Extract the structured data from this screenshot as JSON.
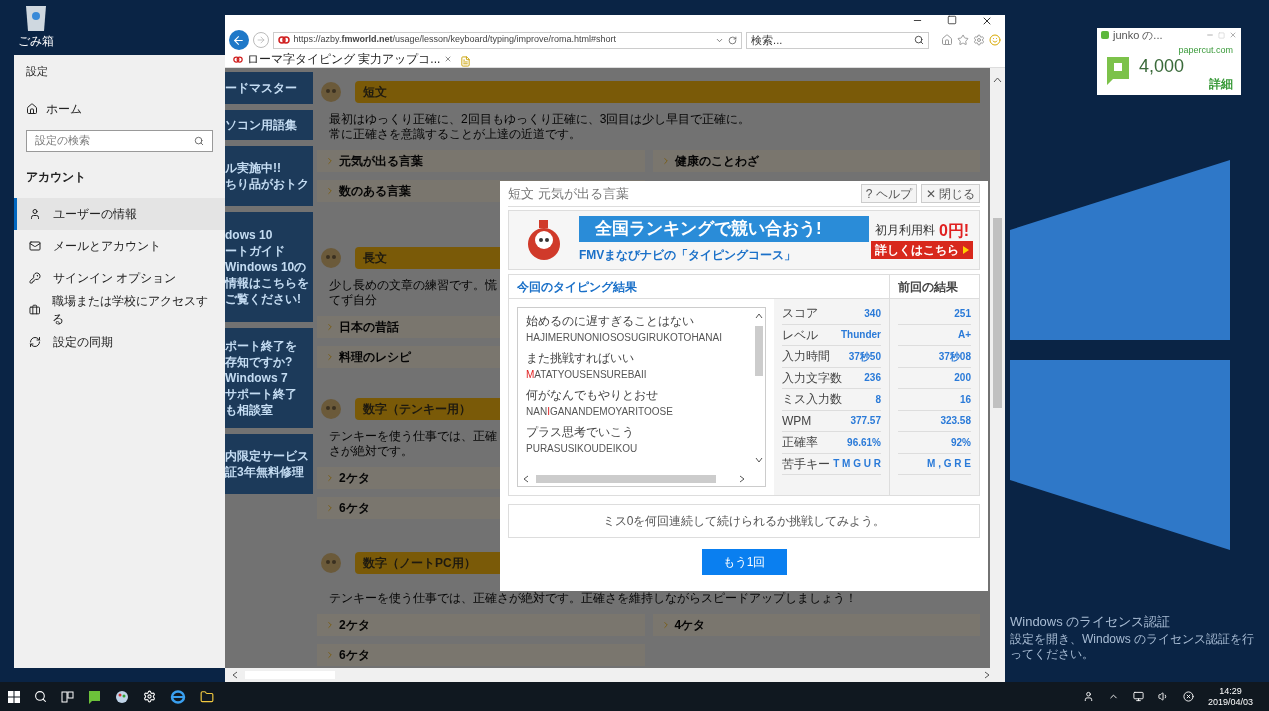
{
  "desktop": {
    "recycle_bin": "ごみ箱"
  },
  "settings": {
    "title": "設定",
    "home": "ホーム",
    "search": {
      "placeholder": "設定の検索"
    },
    "section": "アカウント",
    "items": [
      {
        "label": "ユーザーの情報",
        "selected": true
      },
      {
        "label": "メールとアカウント",
        "selected": false
      },
      {
        "label": "サインイン オプション",
        "selected": false
      },
      {
        "label": "職場または学校にアクセスする",
        "selected": false
      },
      {
        "label": "設定の同期",
        "selected": false
      }
    ]
  },
  "browser": {
    "url": "https://azby.**fmworld.net**/usage/lesson/keyboard/typing/improve/roma.html#short",
    "search": {
      "placeholder": "検索..."
    },
    "tab": "ローマ字タイピング 実力アップコ..."
  },
  "page": {
    "banners": [
      {
        "lines": [
          "ードマスター"
        ]
      },
      {
        "lines": [
          "ソコン用語集"
        ]
      },
      {
        "lines": [
          "ル実施中!!",
          "ちり品がおトク"
        ]
      },
      {
        "lines": [
          "dows 10",
          "ートガイド",
          "Windows 10の",
          "情報はこちらを",
          "ご覧ください!"
        ]
      },
      {
        "lines": [
          "ポート終了を",
          "存知ですか?",
          "Windows 7",
          "サポート終了",
          "も相談室"
        ]
      },
      {
        "lines": [
          "内限定サービス",
          "証3年無料修理"
        ]
      }
    ],
    "sections": [
      {
        "title": "短文",
        "description": [
          "最初はゆっくり正確に、2回目もゆっくり正確に、3回目は少し早目で正確に。",
          "常に正確さを意識することが上達の近道です。"
        ],
        "links": [
          [
            "元気が出る言葉",
            "健康のことわざ"
          ],
          [
            "数のある言葉"
          ]
        ]
      },
      {
        "title": "長文",
        "description": [
          "少し長めの文章の練習です。慌てず自分"
        ],
        "links": [
          [
            "日本の昔話"
          ],
          [
            "料理のレシピ"
          ]
        ]
      },
      {
        "title": "数字（テンキー用）",
        "description": [
          "テンキーを使う仕事では、正確さが絶対です。"
        ],
        "links": [
          [
            "2ケタ"
          ],
          [
            "6ケタ"
          ]
        ]
      },
      {
        "title": "数字（ノートPC用）",
        "description": [
          "テンキーを使う仕事では、正確さが絶対です。正確さを維持しながらスピードアップしましょう！"
        ],
        "links": [
          [
            "2ケタ",
            "4ケタ"
          ],
          [
            "6ケタ"
          ]
        ]
      }
    ]
  },
  "modal": {
    "title": "短文 元気が出る言葉",
    "help": "? ヘルプ",
    "close": "✕ 閉じる",
    "ad": {
      "headline": "全国ランキングで競い合おう!",
      "subline": "FMVまなびナビの「タイピングコース」",
      "price_label": "初月利用料",
      "price": "0円!",
      "cta": "詳しくはこちら"
    },
    "results_title": "今回のタイピング結果",
    "previous_title": "前回の結果",
    "sentences": [
      {
        "text": "始めるのに遅すぎることはない",
        "romaji": [
          {
            "text": "HAJIMERUNONIOSOSUGIRUKOTOHANAI",
            "miss": false
          }
        ]
      },
      {
        "text": "また挑戦すればいい",
        "romaji": [
          {
            "text": "M",
            "miss": true
          },
          {
            "text": "ATATYOUSENSUREBAII",
            "miss": false
          }
        ]
      },
      {
        "text": "何がなんでもやりとおせ",
        "romaji": [
          {
            "text": "NAN",
            "miss": false
          },
          {
            "text": "I",
            "miss": true
          },
          {
            "text": "GANANDEMOYARITOOSE",
            "miss": false
          }
        ]
      },
      {
        "text": "プラス思考でいこう",
        "romaji": [
          {
            "text": "PURASUSIKOUDEIKOU",
            "miss": false
          }
        ]
      }
    ],
    "stats": [
      {
        "label": "スコア",
        "current": "340",
        "previous": "251"
      },
      {
        "label": "レベル",
        "current": "Thunder",
        "previous": "A+"
      },
      {
        "label": "入力時間",
        "current": "37秒50",
        "previous": "37秒08"
      },
      {
        "label": "入力文字数",
        "current": "236",
        "previous": "200"
      },
      {
        "label": "ミス入力数",
        "current": "8",
        "previous": "16"
      },
      {
        "label": "WPM",
        "current": "377.57",
        "previous": "323.58"
      },
      {
        "label": "正確率",
        "current": "96.61%",
        "previous": "92%"
      },
      {
        "label": "苦手キー",
        "current": "T M G U R",
        "previous": "M , G R E"
      }
    ],
    "message": "ミス0を何回連続して続けられるか挑戦してみよう。",
    "retry": "もう1回"
  },
  "widget": {
    "title": "junko の...",
    "site": "papercut.com",
    "balance": "4,000",
    "details": "詳細"
  },
  "activation": {
    "title": "Windows のライセンス認証",
    "text": "設定を開き、Windows のライセンス認証を行ってください。"
  },
  "taskbar": {
    "time": "14:29",
    "date": "2019/04/03"
  }
}
